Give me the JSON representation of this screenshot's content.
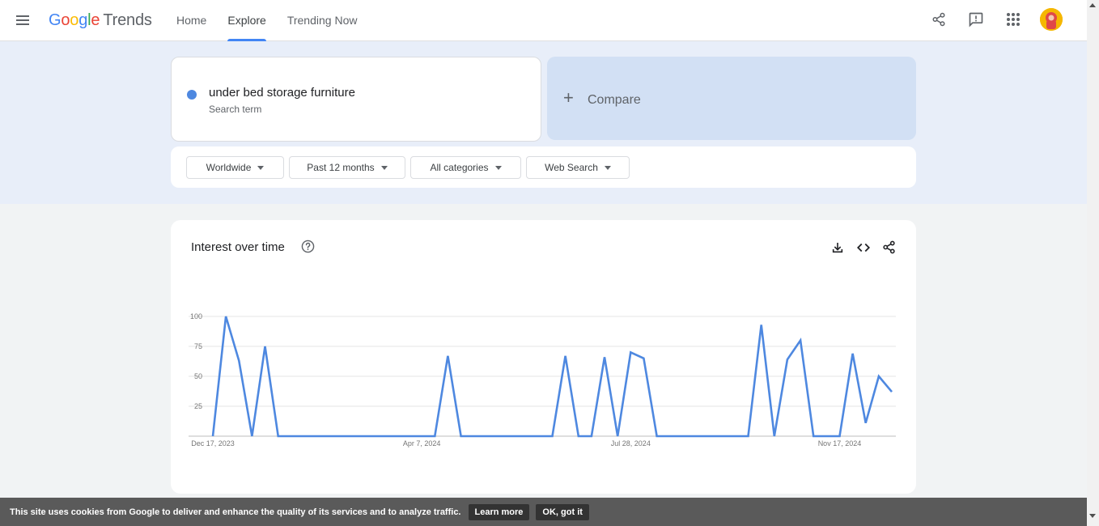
{
  "header": {
    "logo_letters": [
      "G",
      "o",
      "o",
      "g",
      "l",
      "e"
    ],
    "logo_suffix": "Trends",
    "nav": [
      {
        "label": "Home"
      },
      {
        "label": "Explore"
      },
      {
        "label": "Trending Now"
      }
    ],
    "active_nav": "Explore",
    "icons": [
      "menu-icon",
      "share-icon",
      "feedback-icon",
      "apps-icon",
      "avatar"
    ]
  },
  "search": {
    "term": "under bed storage furniture",
    "subtitle": "Search term",
    "term_color": "#4e88e0",
    "compare_label": "Compare"
  },
  "filters": [
    {
      "label": "Worldwide"
    },
    {
      "label": "Past 12 months"
    },
    {
      "label": "All categories"
    },
    {
      "label": "Web Search"
    }
  ],
  "interest_card": {
    "title": "Interest over time",
    "icons": [
      "help-icon",
      "download-icon",
      "embed-icon",
      "share-icon"
    ]
  },
  "chart_data": {
    "type": "line",
    "title": "Interest over time",
    "x_tick_labels": [
      "Dec 17, 2023",
      "Apr 7, 2024",
      "Jul 28, 2024",
      "Nov 17, 2024"
    ],
    "y_ticks": [
      25,
      50,
      75,
      100
    ],
    "ylim": [
      0,
      100
    ],
    "grid": true,
    "series": [
      {
        "color": "#4e88e0",
        "values": [
          0,
          100,
          63,
          0,
          75,
          0,
          0,
          0,
          0,
          0,
          0,
          0,
          0,
          0,
          0,
          0,
          0,
          0,
          67,
          0,
          0,
          0,
          0,
          0,
          0,
          0,
          0,
          67,
          0,
          0,
          66,
          0,
          70,
          65,
          0,
          0,
          0,
          0,
          0,
          0,
          0,
          0,
          93,
          0,
          64,
          80,
          0,
          0,
          0,
          69,
          11,
          50,
          37
        ]
      }
    ]
  },
  "cookie_bar": {
    "text": "This site uses cookies from Google to deliver and enhance the quality of its services and to analyze traffic.",
    "learn_more": "Learn more",
    "ok": "OK, got it"
  }
}
